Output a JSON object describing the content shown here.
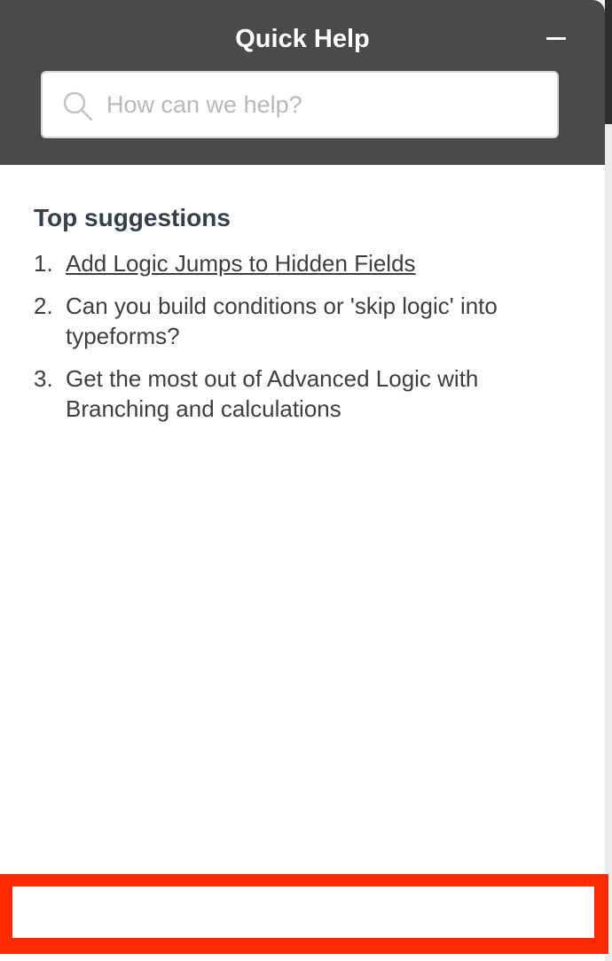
{
  "header": {
    "title": "Quick Help",
    "minimize_label": "Minimize"
  },
  "search": {
    "placeholder": "How can we help?",
    "value": ""
  },
  "suggestions": {
    "heading": "Top suggestions",
    "items": [
      {
        "number": "1.",
        "text": "Add Logic Jumps to Hidden Fields",
        "is_link": true
      },
      {
        "number": "2.",
        "text": "Can you build conditions or 'skip logic' into typeforms?",
        "is_link": false
      },
      {
        "number": "3.",
        "text": "Get the most out of Advanced Logic with Branching and calculations",
        "is_link": false
      }
    ]
  },
  "colors": {
    "header_bg": "#4a4a4a",
    "highlight": "#ff2a00",
    "text": "#3e3e3e"
  },
  "icons": {
    "search": "search-icon",
    "minimize": "minus-icon"
  }
}
